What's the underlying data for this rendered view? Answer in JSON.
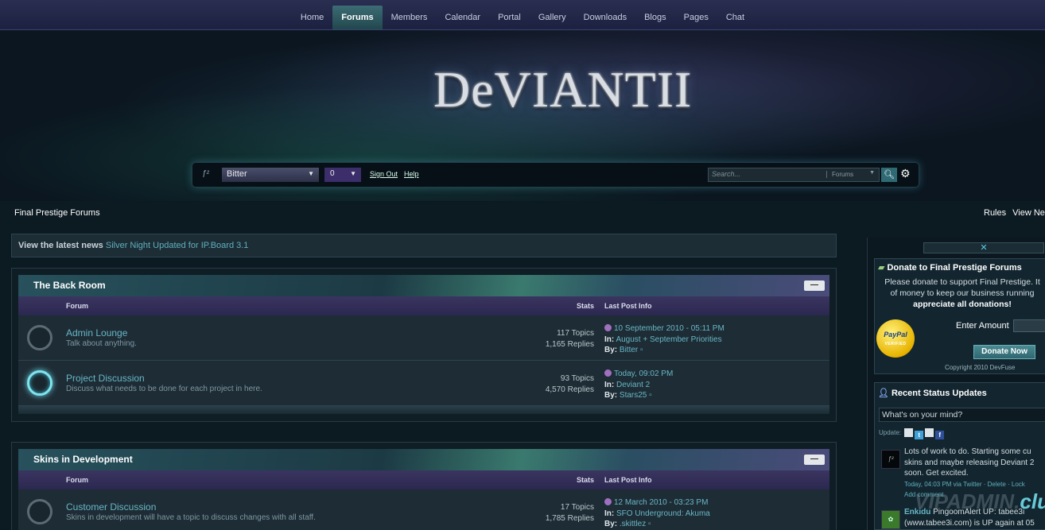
{
  "nav": {
    "items": [
      "Home",
      "Forums",
      "Members",
      "Calendar",
      "Portal",
      "Gallery",
      "Downloads",
      "Blogs",
      "Pages",
      "Chat"
    ],
    "active": "Forums"
  },
  "logo": {
    "text": "DeVIANTII"
  },
  "userbar": {
    "username": "Bitter",
    "notification_count": "0",
    "sign_out": "Sign Out",
    "help": "Help",
    "search_placeholder": "Search...",
    "search_scope": "Forums"
  },
  "breadcrumb": "Final Prestige Forums",
  "right_links": [
    "Rules",
    "View Ne"
  ],
  "news": {
    "label": "View the latest news",
    "link": "Silver Night Updated for IP.Board 3.1"
  },
  "categories": [
    {
      "title": "The Back Room",
      "columns": {
        "forum": "Forum",
        "stats": "Stats",
        "last": "Last Post Info"
      },
      "forums": [
        {
          "title": "Admin Lounge",
          "desc": "Talk about anything.",
          "topics": "117 Topics",
          "replies": "1,165 Replies",
          "date": "10 September 2010 - 05:11 PM",
          "in_label": "In:",
          "in": "August + September Priorities",
          "by_label": "By:",
          "by": "Bitter",
          "has_new": false
        },
        {
          "title": "Project Discussion",
          "desc": "Discuss what needs to be done for each project in here.",
          "topics": "93 Topics",
          "replies": "4,570 Replies",
          "date": "Today, 09:02 PM",
          "in_label": "In:",
          "in": "Deviant 2",
          "by_label": "By:",
          "by": "Stars25",
          "has_new": true
        }
      ]
    },
    {
      "title": "Skins in Development",
      "columns": {
        "forum": "Forum",
        "stats": "Stats",
        "last": "Last Post Info"
      },
      "forums": [
        {
          "title": "Customer Discussion",
          "desc": "Skins in development will have a topic to discuss changes with all staff.",
          "topics": "17 Topics",
          "replies": "1,785 Replies",
          "date": "12 March 2010 - 03:23 PM",
          "in_label": "In:",
          "in": "SFO Underground: Akuma",
          "by_label": "By:",
          "by": ".skittlez",
          "has_new": false
        }
      ]
    }
  ],
  "sidebar": {
    "close": "✕",
    "donate": {
      "title": "Donate to Final Prestige Forums",
      "line1": "Please donate to support Final Prestige. It",
      "line2": "of money to keep our business running",
      "line3": "appreciate all donations!",
      "paypal": "PayPal",
      "paypal_sub": "VERIFIED",
      "amount_label": "Enter Amount",
      "button": "Donate Now",
      "copyright": "Copyright 2010 DevFuse"
    },
    "status": {
      "title": "Recent Status Updates",
      "input_placeholder": "What's on your mind?",
      "update_label": "Update:",
      "entries": [
        {
          "line1": "Lots of work to do. Starting some cu",
          "line2": "skins and maybe releasing Deviant 2",
          "line3": "soon. Get excited.",
          "meta": "Today, 04:03 PM via Twitter · Delete · Lock",
          "meta2": "Add comment"
        },
        {
          "name": "Enkidu",
          "line1": "PingoomAlert UP: tabee3i",
          "line2": "(www.tabee3i.com) is UP again at 05"
        }
      ]
    }
  },
  "watermark": {
    "a": "VIPADMIN.",
    "b": "club"
  }
}
